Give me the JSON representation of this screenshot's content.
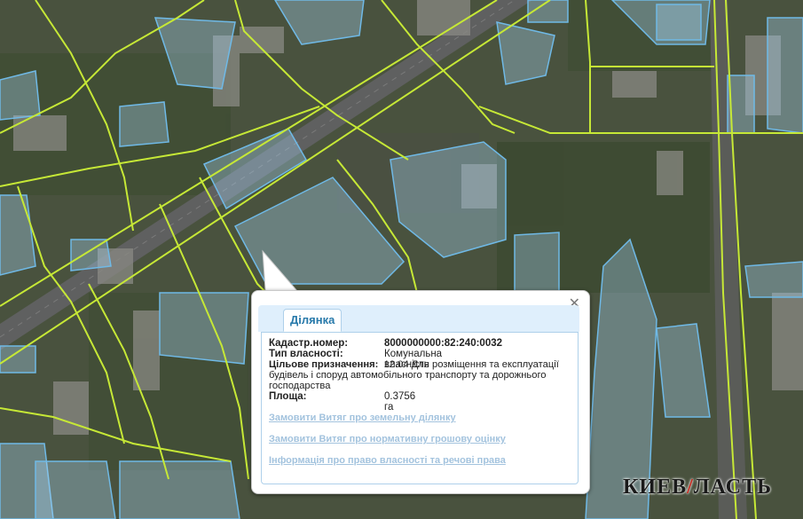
{
  "popup": {
    "tab_label": "Ділянка",
    "close_glyph": "✕",
    "fields": [
      {
        "label": "Кадастр.номер:",
        "value": "8000000000:82:240:0032"
      },
      {
        "label": "Тип власності:",
        "value": "Комунальна власність"
      },
      {
        "label": "Цільове призначення:",
        "value": "12.04 Для розміщення та експлуатації будівель і споруд автомобільного транспорту та дорожнього господарства"
      },
      {
        "label": "Площа:",
        "value": "0.3756 га"
      }
    ],
    "links": [
      "Замовити Витяг про земельну ділянку",
      "Замовити Витяг про нормативну грошову оцінку",
      "Інформація про право власності та речові права"
    ]
  },
  "watermark": {
    "part1": "КИЕВ",
    "part2": "ЛАСТЬ"
  },
  "colors": {
    "road_lines": "#c6e836",
    "parcel_stroke": "#6fb9e6",
    "parcel_fill": "#a9d8f5",
    "link": "#a3c3de",
    "tab_text": "#2779aa"
  }
}
